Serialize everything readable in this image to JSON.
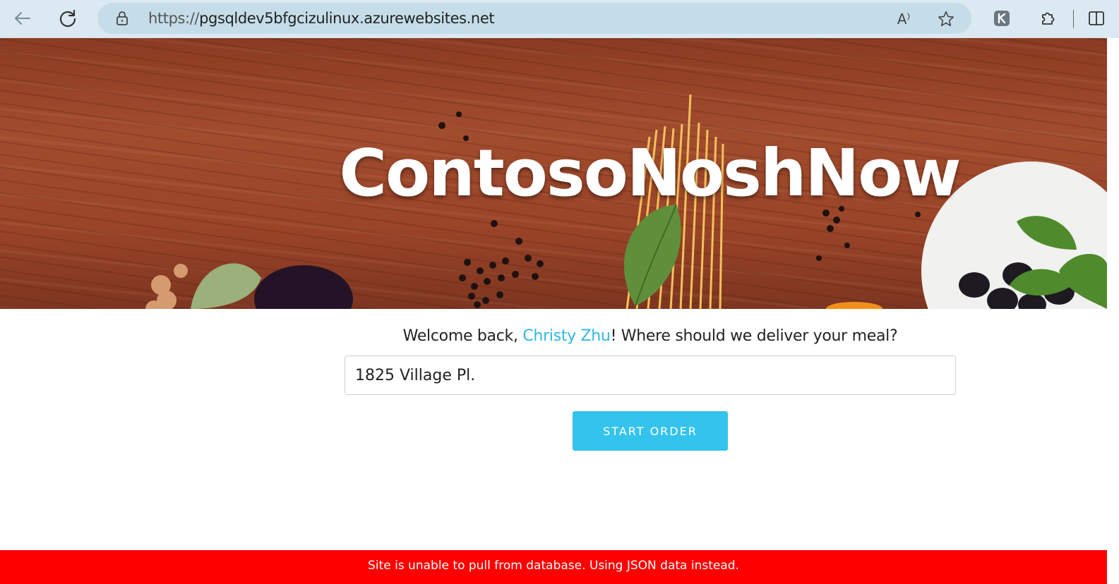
{
  "browser": {
    "url_protocol": "https://",
    "url_host": "pgsqldev5bfgcizulinux.azurewebsites.net",
    "icons": [
      "back-icon",
      "refresh-icon",
      "lock-icon",
      "read-aloud-icon",
      "favorite-star-icon",
      "extension-badge-icon",
      "extensions-puzzle-icon",
      "split-screen-icon"
    ],
    "read_aloud_glyph": "A⁾"
  },
  "hero": {
    "title": "ContosoNoshNow"
  },
  "main": {
    "welcome_prefix": "Welcome back, ",
    "user_name": "Christy Zhu",
    "welcome_suffix": "! Where should we deliver your meal?",
    "address_value": "1825 Village Pl.",
    "start_button_label": "START ORDER"
  },
  "alert": {
    "message": "Site is unable to pull from database. Using JSON data instead."
  },
  "colors": {
    "accent": "#33c3ec",
    "link": "#2fb8e0",
    "error": "#ff0000"
  }
}
